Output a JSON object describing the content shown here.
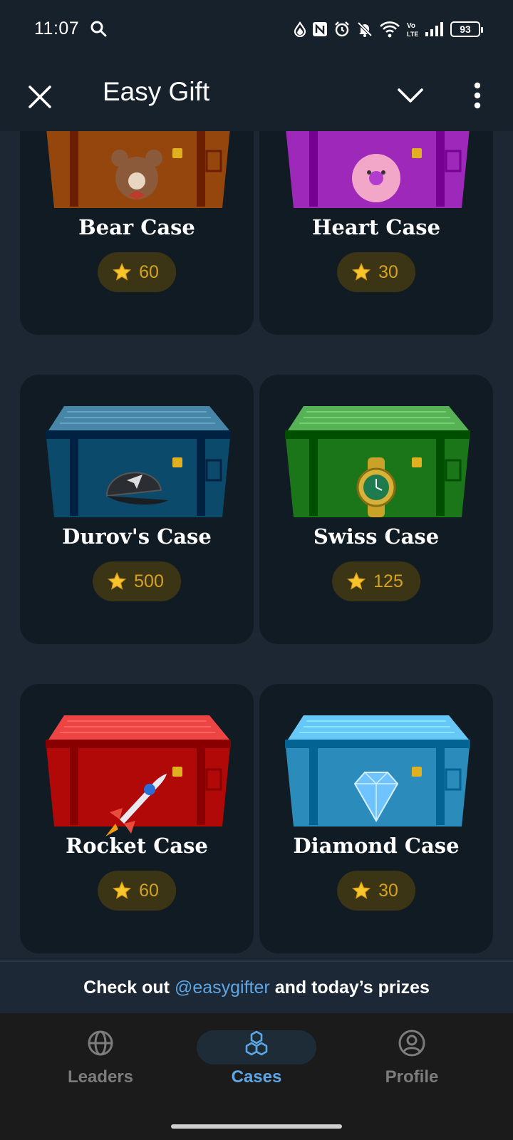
{
  "status_bar": {
    "time": "11:07",
    "battery": "93"
  },
  "app_bar": {
    "title": "Easy Gift"
  },
  "cases": [
    {
      "name": "Bear Case",
      "price": "60",
      "color": "#a85a20",
      "icon": "teddy-bear-icon"
    },
    {
      "name": "Heart Case",
      "price": "30",
      "color": "#b23ccd",
      "icon": "heart-donut-icon"
    },
    {
      "name": "Durov's Case",
      "price": "500",
      "color": "#1f5e7e",
      "icon": "cap-icon"
    },
    {
      "name": "Swiss Case",
      "price": "125",
      "color": "#2f8a2e",
      "icon": "watch-icon"
    },
    {
      "name": "Rocket Case",
      "price": "60",
      "color": "#c51c1c",
      "icon": "rocket-icon"
    },
    {
      "name": "Diamond Case",
      "price": "30",
      "color": "#3fa0cf",
      "icon": "diamond-icon"
    }
  ],
  "promo": {
    "prefix": "Check out",
    "link": "@easygifter",
    "suffix": "and today’s prizes"
  },
  "bottom_nav": {
    "items": [
      {
        "label": "Leaders",
        "icon": "globe-icon",
        "active": false
      },
      {
        "label": "Cases",
        "icon": "cubes-icon",
        "active": true
      },
      {
        "label": "Profile",
        "icon": "user-circle-icon",
        "active": false
      }
    ]
  },
  "colors": {
    "accent": "#5ea6e3",
    "price_text": "#d4a21e",
    "card_bg": "#111b24",
    "header_bg": "#17212b"
  }
}
